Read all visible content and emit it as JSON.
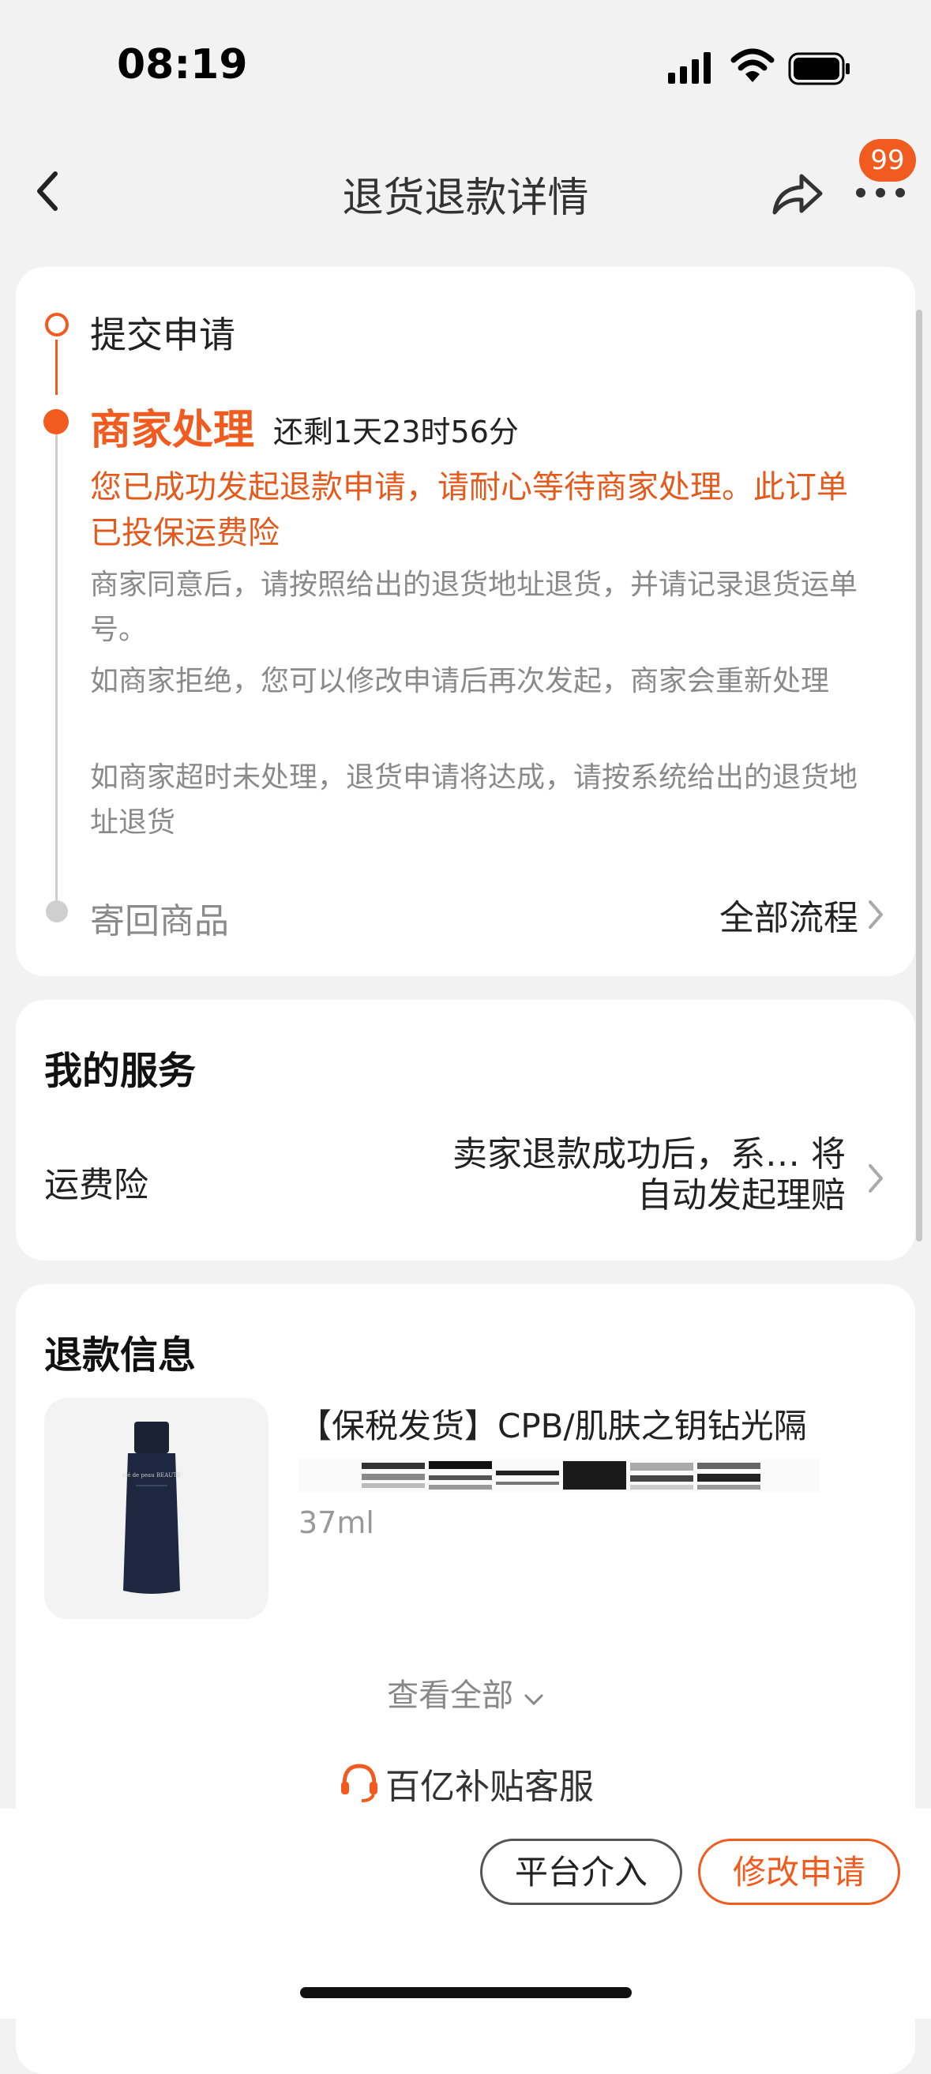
{
  "status_bar": {
    "time": "08:19"
  },
  "nav": {
    "title": "退货退款详情",
    "badge_count": "99"
  },
  "progress": {
    "step_submit": "提交申请",
    "step_merchant": "商家处理",
    "countdown": "还剩1天23时56分",
    "notice": "您已成功发起退款申请，请耐心等待商家处理。此订单已投保运费险",
    "tips": [
      "商家同意后，请按照给出的退货地址退货，并请记录退货运单号。",
      "如商家拒绝，您可以修改申请后再次发起，商家会重新处理",
      "如商家超时未处理，退货申请将达成，请按系统给出的退货地址退货"
    ],
    "step_return": "寄回商品",
    "all_flow": "全部流程"
  },
  "service": {
    "title": "我的服务",
    "label": "运费险",
    "value": "卖家退款成功后，系… 将自动发起理赔"
  },
  "refund": {
    "title": "退款信息",
    "product_title": "【保税发货】CPB/肌肤之钥钻光隔",
    "product_spec": "37ml",
    "product_brand_on_bottle": "clé de peau BEAUTÉ",
    "view_all": "查看全部",
    "customer_service": "百亿补贴客服"
  },
  "actions": {
    "platform": "平台介入",
    "modify": "修改申请"
  },
  "colors": {
    "accent": "#f25b1f",
    "gray_text": "#8a8a8a",
    "background": "#f2f2f2"
  }
}
